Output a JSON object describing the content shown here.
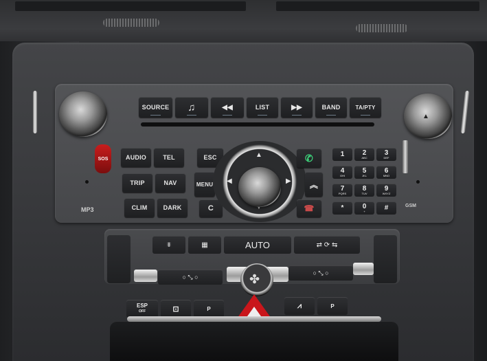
{
  "radio": {
    "top_buttons": [
      "SOURCE",
      "♫",
      "◀◀",
      "LIST",
      "▶▶",
      "BAND",
      "TA/PTY"
    ],
    "left_buttons": [
      "AUDIO",
      "TEL",
      "TRIP",
      "NAV",
      "CLIM",
      "DARK"
    ],
    "center_buttons": [
      "ESC",
      "MENU",
      "C"
    ],
    "sos_label": "SOS",
    "mp3_label": "MP3",
    "brand_label": "GSM",
    "eject_symbol": "▲",
    "keypad": [
      {
        "digit": "1",
        "letters": ""
      },
      {
        "digit": "2",
        "letters": "ABC"
      },
      {
        "digit": "3",
        "letters": "DEF"
      },
      {
        "digit": "4",
        "letters": "GHI"
      },
      {
        "digit": "5",
        "letters": "JKL"
      },
      {
        "digit": "6",
        "letters": "MNO"
      },
      {
        "digit": "7",
        "letters": "PQRS"
      },
      {
        "digit": "8",
        "letters": "TUV"
      },
      {
        "digit": "9",
        "letters": "WXYZ"
      },
      {
        "digit": "*",
        "letters": ""
      },
      {
        "digit": "0",
        "letters": "+"
      },
      {
        "digit": "#",
        "letters": ""
      }
    ]
  },
  "climate": {
    "auto_label": "AUTO",
    "seat_left_symbol": "○ ⤡ ○",
    "seat_right_symbol": "○ ⤡ ○"
  },
  "bottom": {
    "esp_label": "ESP",
    "esp_sub": "OFF",
    "lock_symbol": "🔒",
    "child_label": "P",
    "hazard_symbol": "▲",
    "park_label": "P"
  },
  "colors": {
    "hazard": "#c9161b",
    "sos": "#c91d1d",
    "accent_green": "#3dd17a"
  }
}
